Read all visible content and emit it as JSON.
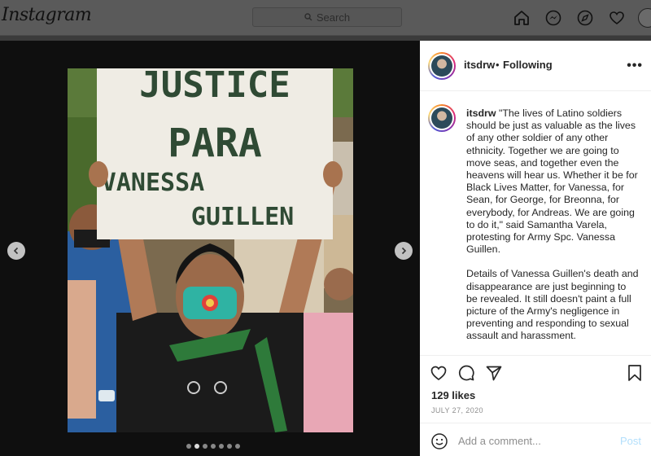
{
  "nav": {
    "logo": "Instagram",
    "search_placeholder": "Search",
    "icons": [
      "home-icon",
      "messenger-icon",
      "explore-icon",
      "heart-icon",
      "profile-avatar"
    ]
  },
  "post": {
    "username": "itsdrw",
    "separator": "•",
    "follow_status": "Following",
    "more": "•••",
    "caption_user": "itsdrw",
    "caption_p1": "\"The lives of Latino soldiers should be just as valuable as the lives of any other soldier of any other ethnicity. Together we are going to move seas, and together even the heavens will hear us. Whether it be for Black Lives Matter, for Vanessa, for Sean, for George, for Breonna, for everybody, for Andreas. We are going to do it,\" said Samantha Varela, protesting for Army Spc. Vanessa Guillen.",
    "caption_p2": "Details of Vanessa Guillen's death and disappearance are just beginning to be revealed. It still doesn't paint a full picture of the Army's negligence in preventing and responding to sexual assault and harassment.",
    "likes": "129 likes",
    "date": "JULY 27, 2020",
    "carousel": {
      "total": 7,
      "active": 1
    }
  },
  "photo": {
    "sign_line1": "JUSTICE",
    "sign_line2": "PARA",
    "sign_line3": "VANESSA",
    "sign_line4": "GUILLEN"
  },
  "comment": {
    "placeholder": "Add a comment...",
    "post_label": "Post"
  },
  "colors": {
    "post_button_disabled": "#b2dffc",
    "overlay_bg": "#0f0f0f",
    "panel_bg": "#ffffff"
  }
}
